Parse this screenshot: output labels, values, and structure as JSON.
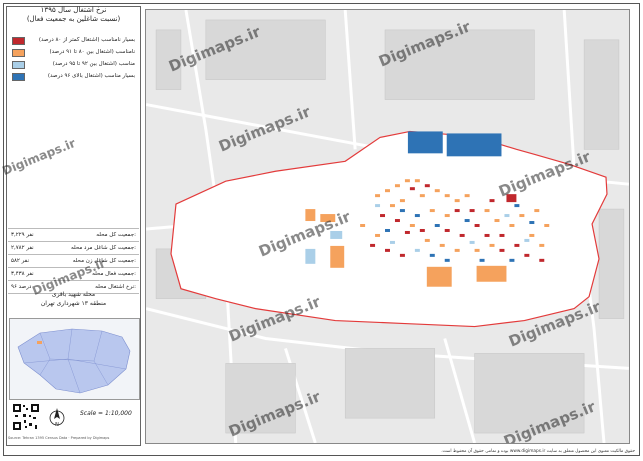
{
  "title_lines": [
    "نرخ اشتغال سال ۱۳۹۵",
    "(نسبت شاغلین به جمعیت فعال)"
  ],
  "legend": [
    {
      "label": "بسیار نامناسب (اشتغال کمتر از ۸۰ درصد)",
      "color": "#c0282d"
    },
    {
      "label": "نامناسب (اشتغال بین ۸۰ تا ۹۱ درصد)",
      "color": "#f5a25d"
    },
    {
      "label": "مناسب (اشتغال بین ۹۲ تا ۹۵ درصد)",
      "color": "#aacfe8"
    },
    {
      "label": "بسیار مناسب (اشتغال بالای ۹۶ درصد)",
      "color": "#2e73b5"
    }
  ],
  "stats": [
    {
      "label": "جمعیت کل محله:",
      "value": "۳,۲۲۹ نفر"
    },
    {
      "label": "جمعیت کل شاغل مرد محله:",
      "value": "۲,۷۸۲ نفر"
    },
    {
      "label": "جمعیت کل شاغل زن محله:",
      "value": "۵۸۲ نفر"
    },
    {
      "label": "جمعیت فعال محله:",
      "value": "۳,۴۳۸ نفر"
    },
    {
      "label": "نرخ اشتغال محله:",
      "value": "۹۶ درصد"
    }
  ],
  "region": [
    "محله شهید باقری",
    "منطقه ۱۳ شهرداری تهران"
  ],
  "scale": "Scale = 1:10,000",
  "north_label": "N",
  "footer_left": "Source: Tehran 1395 Census Data · Prepared by Digimaps",
  "watermark": "Digimaps.ir",
  "copyright": "حقوق مالکیت معنوی این محصول متعلق به سایت www.digimaps.ir بوده و تمامی حقوق آن محفوظ است.",
  "colors": {
    "boundary": "#e33b3b",
    "road": "#ffffff",
    "background": "#e9e9e9",
    "block": "#d6d6d6"
  }
}
